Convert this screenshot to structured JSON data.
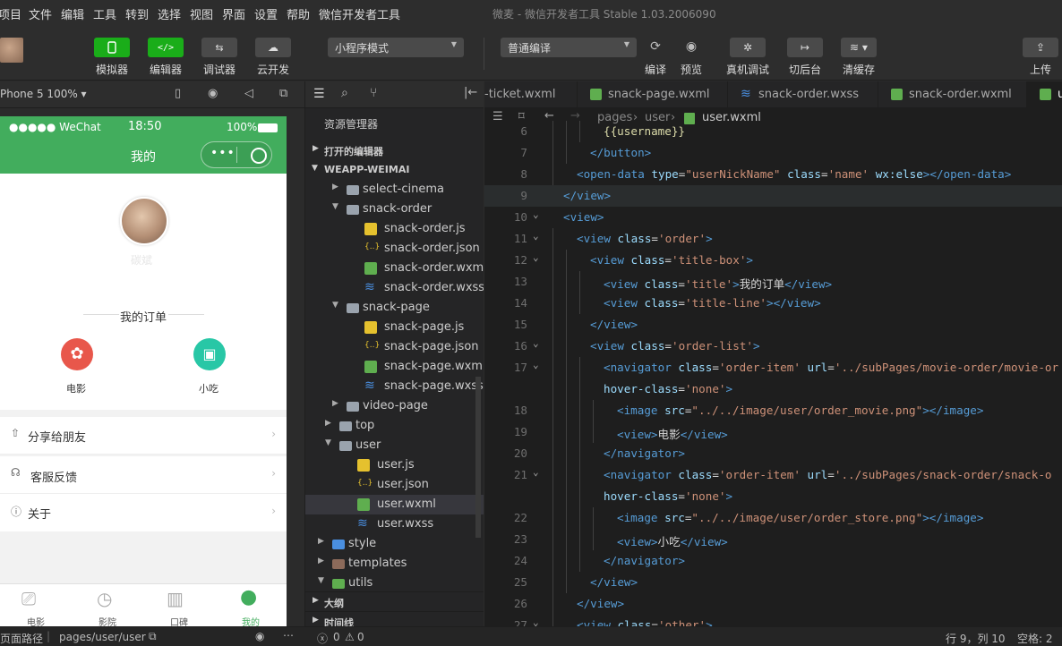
{
  "menu": [
    "项目",
    "文件",
    "编辑",
    "工具",
    "转到",
    "选择",
    "视图",
    "界面",
    "设置",
    "帮助",
    "微信开发者工具"
  ],
  "window_title": "微麦 - 微信开发者工具 Stable 1.03.2006090",
  "toolbar": {
    "simulator": "模拟器",
    "editor": "编辑器",
    "debugger": "调试器",
    "cloud": "云开发",
    "mode_select": "小程序模式",
    "compile_select": "普通编译",
    "compile": "编译",
    "preview": "预览",
    "real_debug": "真机调试",
    "background": "切后台",
    "clear_cache": "清缓存",
    "upload": "上传"
  },
  "simulator": {
    "device": "Phone 5 100% ▾",
    "status_signal": "●●●●● WeChat",
    "status_time": "18:50",
    "status_battery": "100%",
    "nav_title": "我的",
    "username": "碳斌",
    "orders_title": "我的订单",
    "order_movie": "电影",
    "order_snack": "小吃",
    "menu_share": "分享给朋友",
    "menu_service": "客服反馈",
    "menu_about": "关于",
    "tabs": [
      "电影",
      "影院",
      "口碑",
      "我的"
    ],
    "footer_path_label": "页面路径",
    "footer_path": "pages/user/user"
  },
  "explorer": {
    "title": "资源管理器",
    "open_editors": "打开的编辑器",
    "project": "WEAPP-WEIMAI",
    "items": [
      {
        "label": "select-cinema",
        "kind": "folder",
        "indent": 1,
        "open": false
      },
      {
        "label": "snack-order",
        "kind": "folder",
        "indent": 1,
        "open": true
      },
      {
        "label": "snack-order.js",
        "kind": "js",
        "indent": 2
      },
      {
        "label": "snack-order.json",
        "kind": "json",
        "indent": 2
      },
      {
        "label": "snack-order.wxml",
        "kind": "wxml",
        "indent": 2
      },
      {
        "label": "snack-order.wxss",
        "kind": "wxss",
        "indent": 2
      },
      {
        "label": "snack-page",
        "kind": "folder",
        "indent": 1,
        "open": true
      },
      {
        "label": "snack-page.js",
        "kind": "js",
        "indent": 2
      },
      {
        "label": "snack-page.json",
        "kind": "json",
        "indent": 2
      },
      {
        "label": "snack-page.wxml",
        "kind": "wxml",
        "indent": 2
      },
      {
        "label": "snack-page.wxss",
        "kind": "wxss",
        "indent": 2
      },
      {
        "label": "video-page",
        "kind": "folder",
        "indent": 1,
        "open": false
      },
      {
        "label": "top",
        "kind": "folder",
        "indent": 0,
        "open": false
      },
      {
        "label": "user",
        "kind": "folder",
        "indent": 0,
        "open": true
      },
      {
        "label": "user.js",
        "kind": "js",
        "indent": 1
      },
      {
        "label": "user.json",
        "kind": "json",
        "indent": 1
      },
      {
        "label": "user.wxml",
        "kind": "wxml",
        "indent": 1,
        "selected": true
      },
      {
        "label": "user.wxss",
        "kind": "wxss",
        "indent": 1
      },
      {
        "label": "style",
        "kind": "folder-blue",
        "indent": -1,
        "open": false
      },
      {
        "label": "templates",
        "kind": "folder-brown",
        "indent": -1,
        "open": false
      },
      {
        "label": "utils",
        "kind": "folder-green",
        "indent": -1,
        "open": true
      }
    ],
    "outline": "大纲",
    "timeline": "时间线"
  },
  "editor_tabs": [
    {
      "label": "-ticket.wxml",
      "kind": "none"
    },
    {
      "label": "snack-page.wxml",
      "kind": "wxml"
    },
    {
      "label": "snack-order.wxss",
      "kind": "wxss"
    },
    {
      "label": "snack-order.wxml",
      "kind": "wxml"
    },
    {
      "label": "u",
      "kind": "wxml",
      "active": true
    }
  ],
  "breadcrumb": {
    "part1": "pages",
    "part2": "user",
    "file": "user.wxml"
  },
  "code_lines": [
    {
      "n": "6",
      "indent": 3,
      "fold": false,
      "tokens": [
        [
          "t-mus",
          "{{username}}"
        ]
      ]
    },
    {
      "n": "7",
      "indent": 2,
      "fold": false,
      "tokens": [
        [
          "t-tag",
          "</button>"
        ]
      ]
    },
    {
      "n": "8",
      "indent": 1,
      "fold": false,
      "tokens": [
        [
          "t-tag",
          "<open-data "
        ],
        [
          "t-at",
          "type"
        ],
        [
          "t-txt",
          "="
        ],
        [
          "t-str",
          "\"userNickName\""
        ],
        [
          "t-txt",
          " "
        ],
        [
          "t-at",
          "class"
        ],
        [
          "t-txt",
          "="
        ],
        [
          "t-str",
          "'name'"
        ],
        [
          "t-txt",
          " "
        ],
        [
          "t-at",
          "wx:else"
        ],
        [
          "t-tag",
          "></open-data>"
        ]
      ]
    },
    {
      "n": "9",
      "indent": 0,
      "fold": false,
      "hl": true,
      "tokens": [
        [
          "t-tag",
          "</view>"
        ]
      ]
    },
    {
      "n": "10",
      "indent": 0,
      "fold": true,
      "tokens": [
        [
          "t-tag",
          "<view>"
        ]
      ]
    },
    {
      "n": "11",
      "indent": 1,
      "fold": true,
      "tokens": [
        [
          "t-tag",
          "<view "
        ],
        [
          "t-at",
          "class"
        ],
        [
          "t-txt",
          "="
        ],
        [
          "t-str",
          "'order'"
        ],
        [
          "t-tag",
          ">"
        ]
      ]
    },
    {
      "n": "12",
      "indent": 2,
      "fold": true,
      "tokens": [
        [
          "t-tag",
          "<view "
        ],
        [
          "t-at",
          "class"
        ],
        [
          "t-txt",
          "="
        ],
        [
          "t-str",
          "'title-box'"
        ],
        [
          "t-tag",
          ">"
        ]
      ]
    },
    {
      "n": "13",
      "indent": 3,
      "fold": false,
      "tokens": [
        [
          "t-tag",
          "<view "
        ],
        [
          "t-at",
          "class"
        ],
        [
          "t-txt",
          "="
        ],
        [
          "t-str",
          "'title'"
        ],
        [
          "t-tag",
          ">"
        ],
        [
          "t-txt",
          "我的订单"
        ],
        [
          "t-tag",
          "</view>"
        ]
      ]
    },
    {
      "n": "14",
      "indent": 3,
      "fold": false,
      "tokens": [
        [
          "t-tag",
          "<view "
        ],
        [
          "t-at",
          "class"
        ],
        [
          "t-txt",
          "="
        ],
        [
          "t-str",
          "'title-line'"
        ],
        [
          "t-tag",
          "></view>"
        ]
      ]
    },
    {
      "n": "15",
      "indent": 2,
      "fold": false,
      "tokens": [
        [
          "t-tag",
          "</view>"
        ]
      ]
    },
    {
      "n": "16",
      "indent": 2,
      "fold": true,
      "tokens": [
        [
          "t-tag",
          "<view "
        ],
        [
          "t-at",
          "class"
        ],
        [
          "t-txt",
          "="
        ],
        [
          "t-str",
          "'order-list'"
        ],
        [
          "t-tag",
          ">"
        ]
      ]
    },
    {
      "n": "17",
      "indent": 3,
      "fold": true,
      "tokens": [
        [
          "t-tag",
          "<navigator "
        ],
        [
          "t-at",
          "class"
        ],
        [
          "t-txt",
          "="
        ],
        [
          "t-str",
          "'order-item'"
        ],
        [
          "t-txt",
          " "
        ],
        [
          "t-at",
          "url"
        ],
        [
          "t-txt",
          "="
        ],
        [
          "t-str",
          "'../subPages/movie-order/movie-or"
        ]
      ]
    },
    {
      "n": "",
      "indent": 3,
      "fold": false,
      "tokens": [
        [
          "t-at",
          "hover-class"
        ],
        [
          "t-txt",
          "="
        ],
        [
          "t-str",
          "'none'"
        ],
        [
          "t-tag",
          ">"
        ]
      ]
    },
    {
      "n": "18",
      "indent": 4,
      "fold": false,
      "tokens": [
        [
          "t-tag",
          "<image "
        ],
        [
          "t-at",
          "src"
        ],
        [
          "t-txt",
          "="
        ],
        [
          "t-str",
          "\"../../image/user/order_movie.png\""
        ],
        [
          "t-tag",
          "></image>"
        ]
      ]
    },
    {
      "n": "19",
      "indent": 4,
      "fold": false,
      "tokens": [
        [
          "t-tag",
          "<view>"
        ],
        [
          "t-txt",
          "电影"
        ],
        [
          "t-tag",
          "</view>"
        ]
      ]
    },
    {
      "n": "20",
      "indent": 3,
      "fold": false,
      "tokens": [
        [
          "t-tag",
          "</navigator>"
        ]
      ]
    },
    {
      "n": "21",
      "indent": 3,
      "fold": true,
      "tokens": [
        [
          "t-tag",
          "<navigator "
        ],
        [
          "t-at",
          "class"
        ],
        [
          "t-txt",
          "="
        ],
        [
          "t-str",
          "'order-item'"
        ],
        [
          "t-txt",
          " "
        ],
        [
          "t-at",
          "url"
        ],
        [
          "t-txt",
          "="
        ],
        [
          "t-str",
          "'../subPages/snack-order/snack-o"
        ]
      ]
    },
    {
      "n": "",
      "indent": 3,
      "fold": false,
      "tokens": [
        [
          "t-at",
          "hover-class"
        ],
        [
          "t-txt",
          "="
        ],
        [
          "t-str",
          "'none'"
        ],
        [
          "t-tag",
          ">"
        ]
      ]
    },
    {
      "n": "22",
      "indent": 4,
      "fold": false,
      "tokens": [
        [
          "t-tag",
          "<image "
        ],
        [
          "t-at",
          "src"
        ],
        [
          "t-txt",
          "="
        ],
        [
          "t-str",
          "\"../../image/user/order_store.png\""
        ],
        [
          "t-tag",
          "></image>"
        ]
      ]
    },
    {
      "n": "23",
      "indent": 4,
      "fold": false,
      "tokens": [
        [
          "t-tag",
          "<view>"
        ],
        [
          "t-txt",
          "小吃"
        ],
        [
          "t-tag",
          "</view>"
        ]
      ]
    },
    {
      "n": "24",
      "indent": 3,
      "fold": false,
      "tokens": [
        [
          "t-tag",
          "</navigator>"
        ]
      ]
    },
    {
      "n": "25",
      "indent": 2,
      "fold": false,
      "tokens": [
        [
          "t-tag",
          "</view>"
        ]
      ]
    },
    {
      "n": "26",
      "indent": 1,
      "fold": false,
      "tokens": [
        [
          "t-tag",
          "</view>"
        ]
      ]
    },
    {
      "n": "27",
      "indent": 1,
      "fold": true,
      "tokens": [
        [
          "t-tag",
          "<view "
        ],
        [
          "t-at",
          "class"
        ],
        [
          "t-txt",
          "="
        ],
        [
          "t-str",
          "'other'"
        ],
        [
          "t-tag",
          ">"
        ]
      ]
    }
  ],
  "statusbar": {
    "errors": "0",
    "warnings": "0",
    "position": "行 9，列 10",
    "spaces": "空格: 2"
  },
  "colors": {
    "brand_green": "#42ad5d",
    "toolbar_green": "#1aad19",
    "movie_red": "#e8574b",
    "snack_teal": "#28c7a6"
  }
}
